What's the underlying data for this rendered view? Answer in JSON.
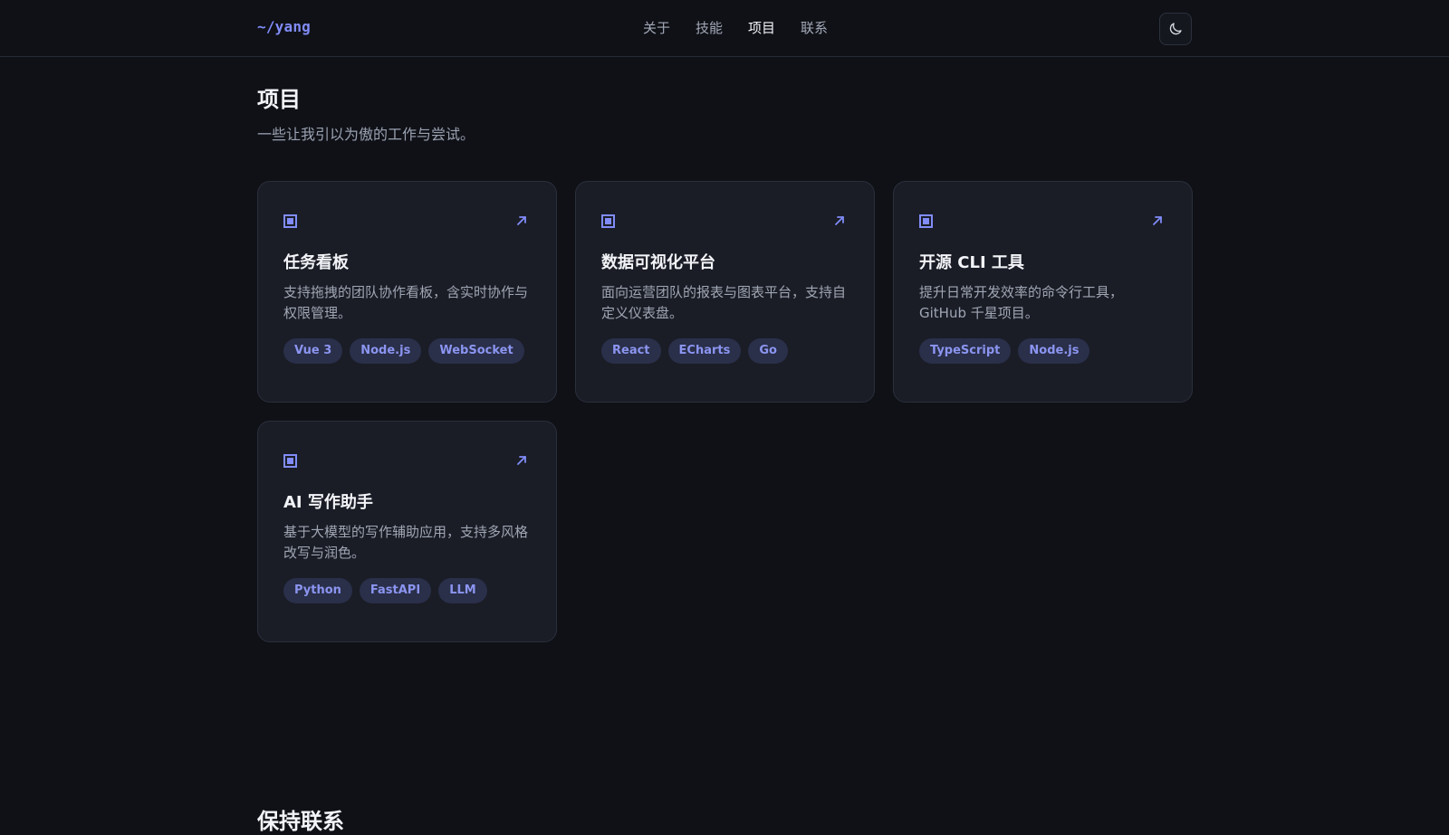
{
  "header": {
    "logo": "~/yang",
    "nav": [
      {
        "label": "关于"
      },
      {
        "label": "技能"
      },
      {
        "label": "项目"
      },
      {
        "label": "联系"
      }
    ],
    "active_nav": "项目",
    "theme_toggle_icon": "moon-icon"
  },
  "projects_section": {
    "title": "项目",
    "subtitle": "一些让我引以为傲的工作与尝试。",
    "cards": [
      {
        "title": "任务看板",
        "description": "支持拖拽的团队协作看板，含实时协作与权限管理。",
        "tags": [
          "Vue 3",
          "Node.js",
          "WebSocket"
        ]
      },
      {
        "title": "数据可视化平台",
        "description": "面向运营团队的报表与图表平台，支持自定义仪表盘。",
        "tags": [
          "React",
          "ECharts",
          "Go"
        ]
      },
      {
        "title": "开源 CLI 工具",
        "description": "提升日常开发效率的命令行工具，GitHub 千星项目。",
        "tags": [
          "TypeScript",
          "Node.js"
        ]
      },
      {
        "title": "AI 写作助手",
        "description": "基于大模型的写作辅助应用，支持多风格改写与润色。",
        "tags": [
          "Python",
          "FastAPI",
          "LLM"
        ]
      }
    ]
  },
  "contact_section": {
    "title": "保持联系"
  },
  "colors": {
    "background": "#0f1117",
    "card": "#1a1d26",
    "accent": "#818cf8",
    "tag_bg": "#2a2f4a"
  }
}
